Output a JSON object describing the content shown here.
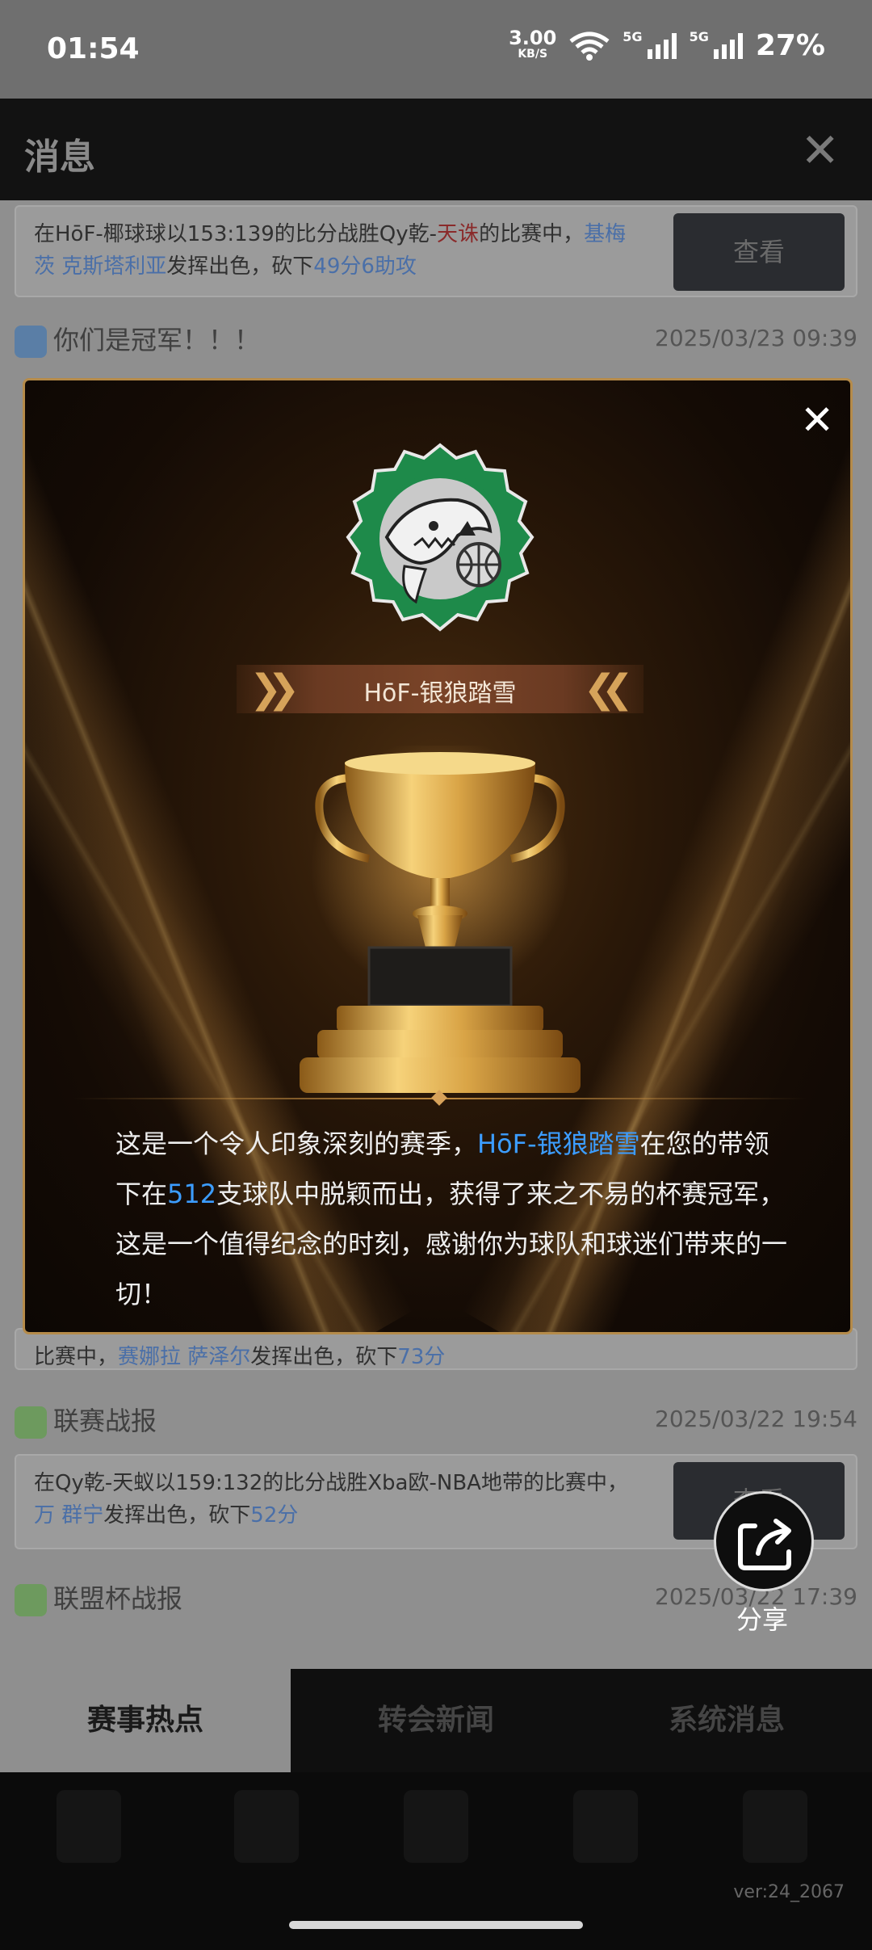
{
  "status": {
    "time": "01:54",
    "speed": "3.00",
    "speed_unit": "KB/S",
    "net1": "5G",
    "net2": "5G",
    "battery": "27%"
  },
  "header": {
    "title": "消息",
    "close": "✕"
  },
  "cards": [
    {
      "parts": [
        "在HōF-椰球球以153:139的比分战胜Qy乾-",
        "天诛",
        "的比赛中，",
        "基梅茨 克斯塔利亚",
        "发挥出色，砍下",
        "49分6助攻"
      ],
      "button": "查看"
    },
    {
      "parts_tail": [
        "比赛中，",
        "赛娜拉 萨泽尔",
        "发挥出色，砍下",
        "73分"
      ]
    },
    {
      "parts": [
        "在Qy乾-天蚁以159:132的比分战胜Xba欧-NBA地带的比赛中，",
        "万 群宁",
        "发挥出色，砍下",
        "52分"
      ],
      "button": "查看"
    }
  ],
  "rows": [
    {
      "title": "你们是冠军！！！",
      "date": "2025/03/23 09:39"
    },
    {
      "title": "联赛战报",
      "date": "2025/03/22 19:54"
    },
    {
      "title": "联盟杯战报",
      "date": "2025/03/22 17:39"
    }
  ],
  "modal": {
    "team_name": "HōF-银狼踏雪",
    "desc": {
      "p1": "这是一个令人印象深刻的赛季，",
      "team": "HōF-银狼踏雪",
      "p2": "在您的带领下在",
      "count": "512",
      "p3": "支球队中脱颖而出，获得了来之不易的杯赛冠军，这是一个值得纪念的时刻，感谢你为球队和球迷们带来的一切！"
    }
  },
  "share_label": "分享",
  "tabs": [
    "赛事热点",
    "转会新闻",
    "系统消息"
  ],
  "version": "ver:24_2067",
  "colors": {
    "accent_blue": "#3c9dff",
    "gold": "#c08a40"
  },
  "icons": [
    "close-icon",
    "team-shark-logo",
    "trophy-icon",
    "share-icon",
    "speaker-icon"
  ]
}
